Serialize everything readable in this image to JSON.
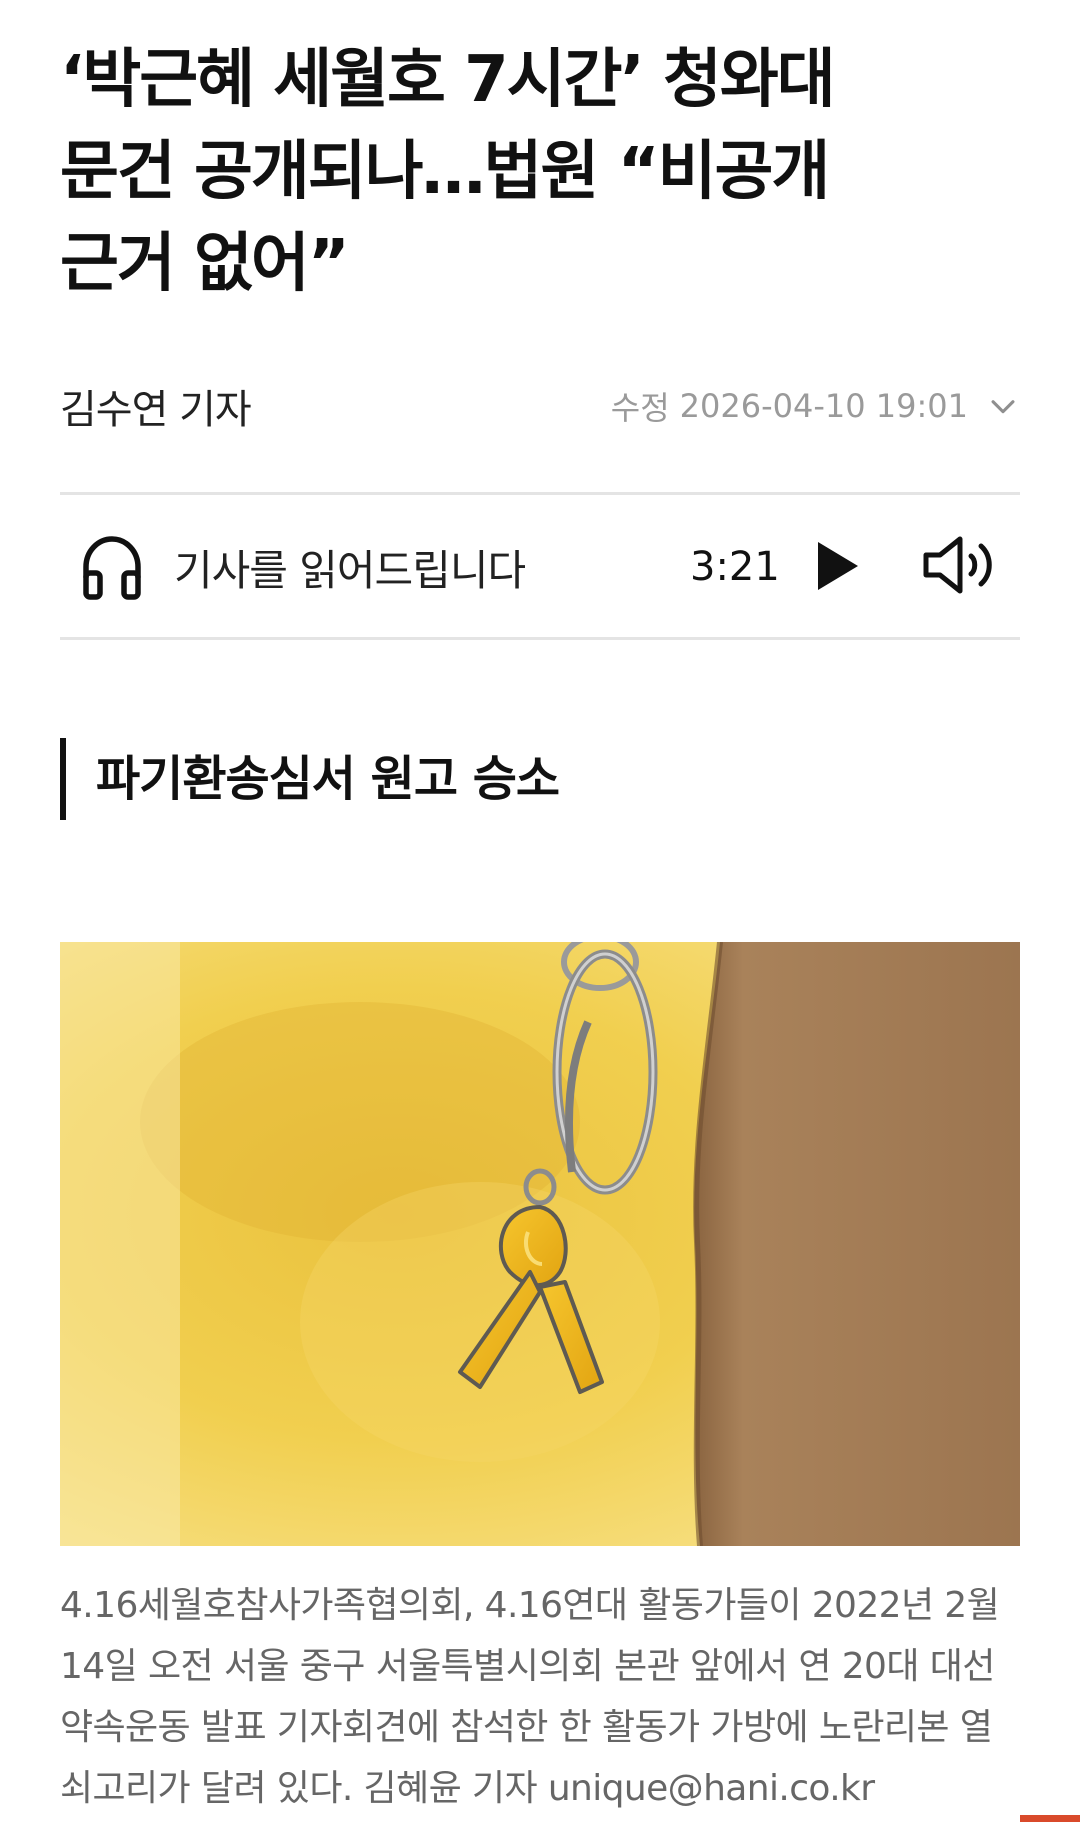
{
  "article": {
    "headline_line1": "‘박근혜 세월호 7시간’ 청와대",
    "headline_line2": "문건 공개되나…법원 “비공개",
    "headline_line3": "근거 없어”",
    "author": "김수연 기자",
    "date_label": "수정",
    "date_value": "2026-04-10 19:01",
    "subtitle": "파기환송심서 원고 승소",
    "caption": "4.16세월호참사가족협의회, 4.16연대 활동가들이 2022년 2월 14일 오전 서울 중구 서울특별시의회 본관 앞에서 연 20대 대선 약속운동 발표 기자회견에 참석한 한 활동가 가방에 노란리본 열쇠고리가 달려 있다. 김혜윤 기자 unique@hani.co.kr"
  },
  "audio": {
    "label": "기사를 읽어드립니다",
    "duration": "3:21",
    "icons": [
      "headphone-icon",
      "play-icon",
      "speaker-icon",
      "chevron-down-icon"
    ]
  },
  "image": {
    "subject": "yellow-ribbon-keychain-photo"
  },
  "colors": {
    "text_primary": "#111111",
    "text_meta": "#9a9a9a",
    "caption": "#666666",
    "divider": "#e4e4e4",
    "ribbon_yellow": "#f2b824",
    "bag_brown": "#a37a51"
  }
}
